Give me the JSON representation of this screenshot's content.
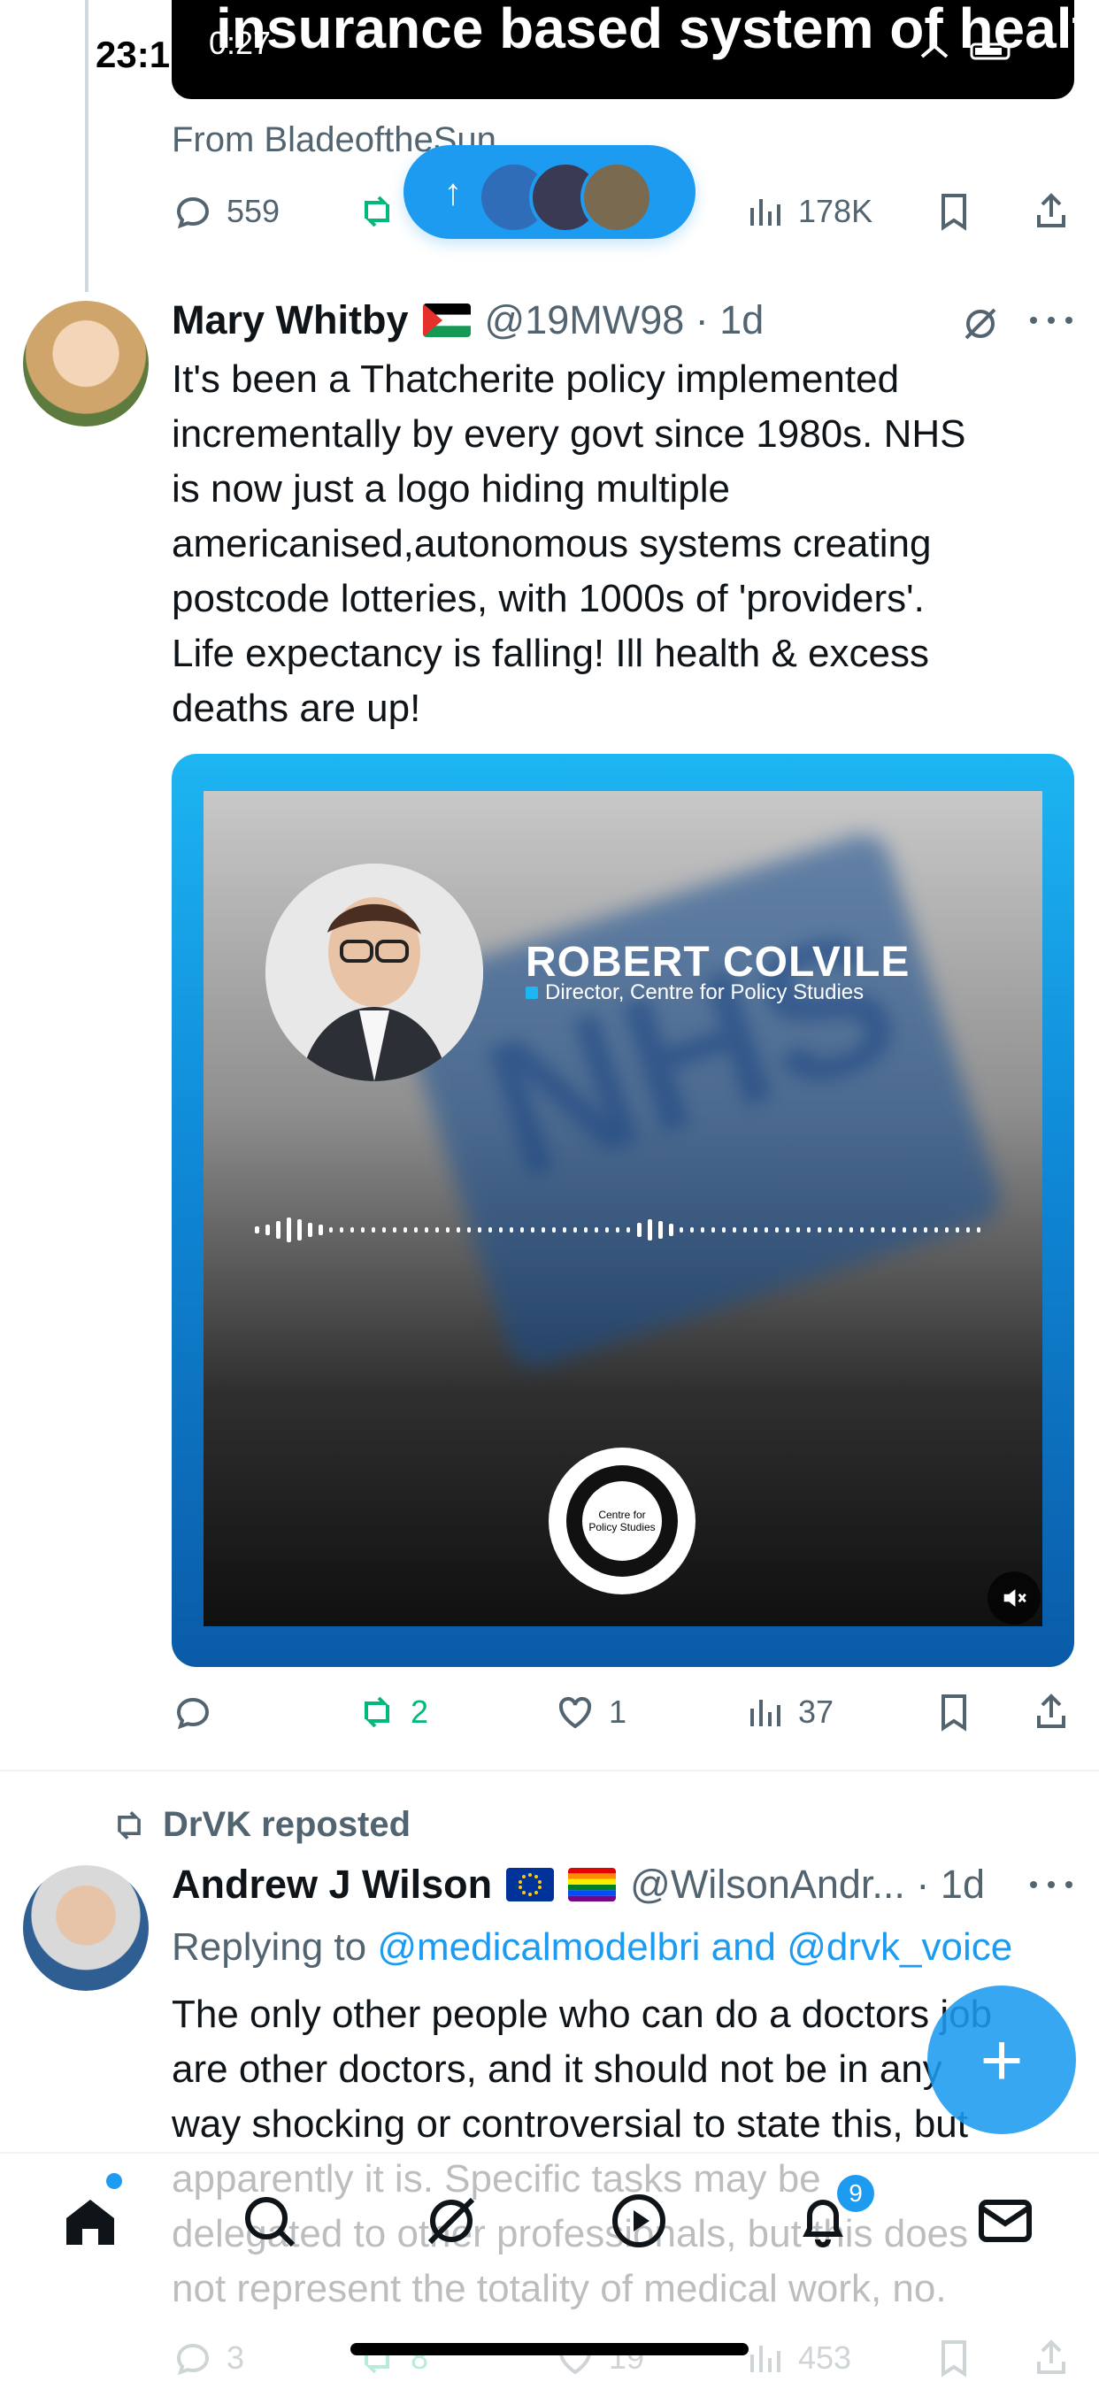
{
  "status_bar": {
    "time": "23:1",
    "video_elapsed": "0:27"
  },
  "prev_tweet": {
    "caption": "insurance based system of health care",
    "from_line": "From BladeoftheSun",
    "actions": {
      "replies": "559",
      "views": "178K"
    }
  },
  "tweet1": {
    "name": "Mary Whitby",
    "handle": "@19MW98 · 1d",
    "body": "It's been a Thatcherite policy implemented\nincrementally by every govt since 1980s. NHS\nis now just a logo hiding multiple\namericanised,autonomous systems creating\npostcode lotteries, with 1000s of 'providers'.\nLife expectancy is falling! Ill health & excess\ndeaths are up!",
    "media": {
      "speaker": "ROBERT COLVILE",
      "role": "Director, Centre for Policy Studies",
      "watermark": "NHS",
      "logo_text": "Centre for Policy Studies"
    },
    "actions": {
      "reposts": "2",
      "likes": "1",
      "views": "37"
    }
  },
  "tweet2": {
    "reposted_by": "DrVK reposted",
    "name": "Andrew J Wilson",
    "handle": "@WilsonAndr... · 1d",
    "reply_prefix": "Replying to ",
    "reply_to": "@medicalmodelbri and @drvk_voice",
    "body": "The only other people who can do a doctors job\nare other doctors, and it should not be in any\nway shocking or controversial to state this, but\napparently it is. Specific tasks may be\ndelegated to other professionals, but this does\nnot represent the totality of medical work, no.",
    "actions": {
      "replies": "3",
      "reposts": "8",
      "likes": "19",
      "views": "453"
    }
  },
  "nav": {
    "notifications_badge": "9"
  },
  "fab": {
    "label": "+"
  }
}
